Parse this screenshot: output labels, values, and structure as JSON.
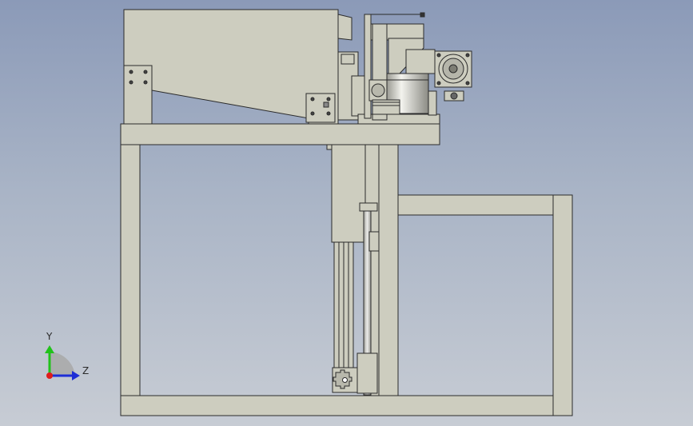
{
  "viewport": {
    "background_top": "#8b9ab8",
    "background_bottom": "#c7ccd4",
    "part_fill": "#cdcdbf",
    "part_stroke": "#2b2b2b"
  },
  "triad": {
    "y_label": "Y",
    "z_label": "Z",
    "y_axis_color": "#21c21b",
    "z_axis_color": "#1e2ed6",
    "x_axis_color": "#e01c1c"
  }
}
